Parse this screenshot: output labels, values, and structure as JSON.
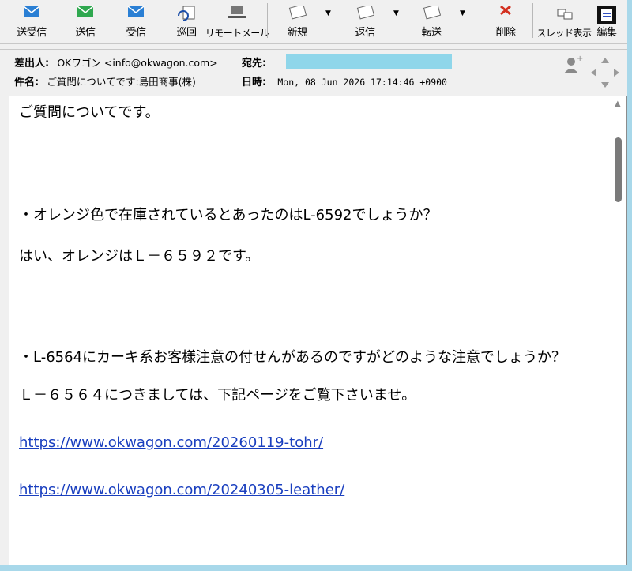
{
  "toolbar": {
    "buttons": [
      {
        "label": "送受信",
        "icon": "send-receive-icon"
      },
      {
        "label": "送信",
        "icon": "send-icon"
      },
      {
        "label": "受信",
        "icon": "receive-icon"
      },
      {
        "label": "巡回",
        "icon": "patrol-icon"
      },
      {
        "label": "リモートメール",
        "icon": "remote-mail-icon"
      },
      {
        "label": "新規",
        "icon": "new-mail-icon"
      },
      {
        "label": "返信",
        "icon": "reply-icon"
      },
      {
        "label": "転送",
        "icon": "forward-icon"
      },
      {
        "label": "削除",
        "icon": "delete-icon"
      },
      {
        "label": "スレッド表示",
        "icon": "thread-view-icon"
      },
      {
        "label": "編集",
        "icon": "edit-icon"
      }
    ]
  },
  "header": {
    "from_label": "差出人:",
    "from_value": "OKワゴン <info@okwagon.com>",
    "to_label": "宛先:",
    "subject_label": "件名:",
    "subject_value": "ご質問についてです:島田商事(株)",
    "date_label": "日時:",
    "date_value": "Mon, 08 Jun 2026 17:14:46 +0900"
  },
  "body": {
    "line1": "ご質問についてです。",
    "line2": "・オレンジ色で在庫されているとあったのはL-6592でしょうか？",
    "line3": "はい、オレンジはＬ－６５９２です。",
    "line4": "・L-6564にカーキ系お客様注意の付せんがあるのですがどのような注意でしょうか？",
    "line5": "Ｌ－６５６４につきましては、下記ページをご覧下さいませ。",
    "link1": "https://www.okwagon.com/20260119-tohr/",
    "link2": "https://www.okwagon.com/20240305-leather/"
  },
  "colors": {
    "background": "#a8d8ea",
    "link": "#1a3fbf",
    "redacted_field": "#8fd6ea"
  }
}
